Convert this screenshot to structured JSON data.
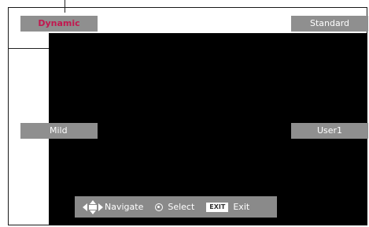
{
  "modes": {
    "top_left": "Dynamic",
    "top_right": "Standard",
    "mid_left": "Mild",
    "mid_right": "User1"
  },
  "active_mode": "Dynamic",
  "navbar": {
    "navigate_label": "Navigate",
    "select_label": "Select",
    "exit_key": "EXIT",
    "exit_label": "Exit"
  },
  "colors": {
    "active_text": "#c2184f",
    "button_bg": "#8f8f8f",
    "screen_bg": "#000000"
  }
}
